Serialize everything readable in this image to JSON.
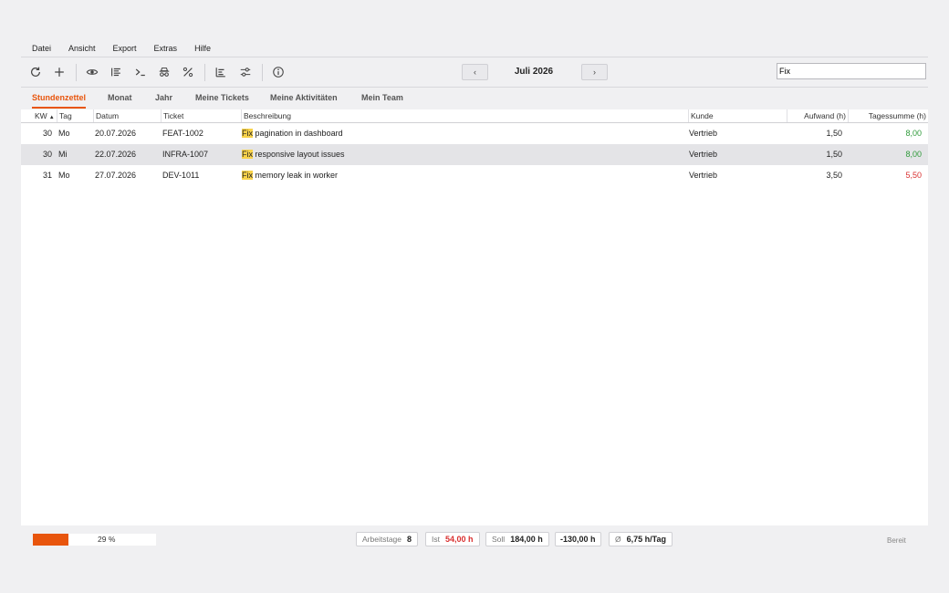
{
  "menu": [
    "Datei",
    "Ansicht",
    "Export",
    "Extras",
    "Hilfe"
  ],
  "toolbar": {
    "icons": [
      "refresh-icon",
      "add-icon",
      "eye-icon",
      "list-icon",
      "terminal-icon",
      "spy-icon",
      "percent-icon",
      "align-left-icon",
      "sliders-icon",
      "info-icon"
    ],
    "prev_label": "‹",
    "next_label": "›",
    "month": "Juli 2026",
    "search_value": "Fix"
  },
  "tabs": [
    {
      "label": "Stundenzettel",
      "active": true
    },
    {
      "label": "Monat",
      "active": false
    },
    {
      "label": "Jahr",
      "active": false
    },
    {
      "label": "Meine Tickets",
      "active": false
    },
    {
      "label": "Meine Aktivitäten",
      "active": false
    },
    {
      "label": "Mein Team",
      "active": false
    }
  ],
  "table": {
    "columns": [
      "KW",
      "Tag",
      "Datum",
      "Ticket",
      "Beschreibung",
      "Kunde",
      "Aufwand (h)",
      "Tagessumme (h)"
    ],
    "sort_indicator": "▲",
    "rows": [
      {
        "kw": "30",
        "tag": "Mo",
        "datum": "20.07.2026",
        "ticket": "FEAT-1002",
        "highlight": "Fix",
        "desc": " pagination in dashboard",
        "kunde": "Vertrieb",
        "aufwand": "1,50",
        "summe": "8,00",
        "status": "ok",
        "selected": false
      },
      {
        "kw": "30",
        "tag": "Mi",
        "datum": "22.07.2026",
        "ticket": "INFRA-1007",
        "highlight": "Fix",
        "desc": " responsive layout issues",
        "kunde": "Vertrieb",
        "aufwand": "1,50",
        "summe": "8,00",
        "status": "ok",
        "selected": true
      },
      {
        "kw": "31",
        "tag": "Mo",
        "datum": "27.07.2026",
        "ticket": "DEV-1011",
        "highlight": "Fix",
        "desc": " memory leak in worker",
        "kunde": "Vertrieb",
        "aufwand": "3,50",
        "summe": "5,50",
        "status": "low",
        "selected": false
      }
    ]
  },
  "status": {
    "progress_percent": 29,
    "progress_text": "29 %",
    "arbeitstage_label": "Arbeitstage",
    "arbeitstage_value": "8",
    "ist_label": "Ist",
    "ist_value": "54,00 h",
    "soll_label": "Soll",
    "soll_value": "184,00 h",
    "diff_value": "-130,00 h",
    "avg_label": "Ø",
    "avg_value": "6,75 h/Tag",
    "ready": "Bereit"
  },
  "colors": {
    "accent": "#e8550d",
    "ok": "#2f9a3a",
    "low": "#d93030",
    "highlight": "#f8d24a"
  }
}
